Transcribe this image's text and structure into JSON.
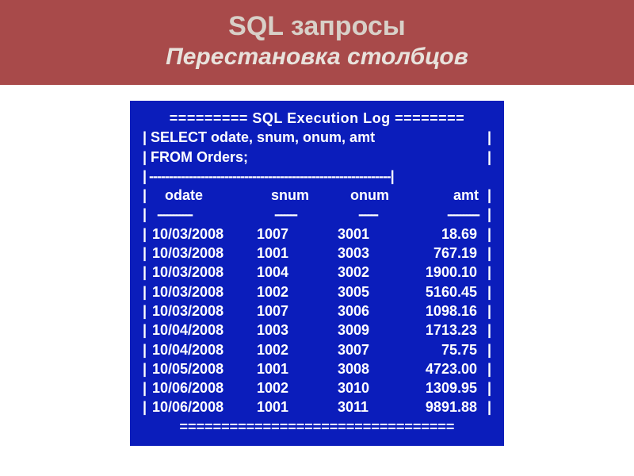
{
  "header": {
    "title": "SQL запросы",
    "subtitle": "Перестановка столбцов"
  },
  "sql": {
    "log_title": "=========  SQL Execution Log  ========",
    "query_line1": "|  SELECT odate, snum, onum, amt",
    "query_line2": "|  FROM Orders;",
    "dashes": "| -------------------------------------------------------------|",
    "headers": {
      "c1": "odate",
      "c2": "snum",
      "c3": "onum",
      "c4": "amt"
    },
    "underlines": {
      "u1": "-----------",
      "u2": "-------",
      "u3": "------",
      "u4": "----------"
    },
    "rows": [
      {
        "odate": "10/03/2008",
        "snum": "1007",
        "onum": "3001",
        "amt": "18.69"
      },
      {
        "odate": "10/03/2008",
        "snum": "1001",
        "onum": "3003",
        "amt": "767.19"
      },
      {
        "odate": "10/03/2008",
        "snum": "1004",
        "onum": "3002",
        "amt": "1900.10"
      },
      {
        "odate": "10/03/2008",
        "snum": "1002",
        "onum": "3005",
        "amt": "5160.45"
      },
      {
        "odate": "10/03/2008",
        "snum": "1007",
        "onum": "3006",
        "amt": "1098.16"
      },
      {
        "odate": "10/04/2008",
        "snum": "1003",
        "onum": "3009",
        "amt": "1713.23"
      },
      {
        "odate": "10/04/2008",
        "snum": "1002",
        "onum": "3007",
        "amt": "75.75"
      },
      {
        "odate": "10/05/2008",
        "snum": "1001",
        "onum": "3008",
        "amt": "4723.00"
      },
      {
        "odate": "10/06/2008",
        "snum": "1002",
        "onum": "3010",
        "amt": "1309.95"
      },
      {
        "odate": "10/06/2008",
        "snum": "1001",
        "onum": "3011",
        "amt": "9891.88"
      }
    ],
    "footer": " ================================="
  },
  "chart_data": {
    "type": "table",
    "title": "SQL Execution Log",
    "query": "SELECT odate, snum, onum, amt FROM Orders;",
    "columns": [
      "odate",
      "snum",
      "onum",
      "amt"
    ],
    "rows": [
      [
        "10/03/2008",
        1007,
        3001,
        18.69
      ],
      [
        "10/03/2008",
        1001,
        3003,
        767.19
      ],
      [
        "10/03/2008",
        1004,
        3002,
        1900.1
      ],
      [
        "10/03/2008",
        1002,
        3005,
        5160.45
      ],
      [
        "10/03/2008",
        1007,
        3006,
        1098.16
      ],
      [
        "10/04/2008",
        1003,
        3009,
        1713.23
      ],
      [
        "10/04/2008",
        1002,
        3007,
        75.75
      ],
      [
        "10/05/2008",
        1001,
        3008,
        4723.0
      ],
      [
        "10/06/2008",
        1002,
        3010,
        1309.95
      ],
      [
        "10/06/2008",
        1001,
        3011,
        9891.88
      ]
    ]
  }
}
